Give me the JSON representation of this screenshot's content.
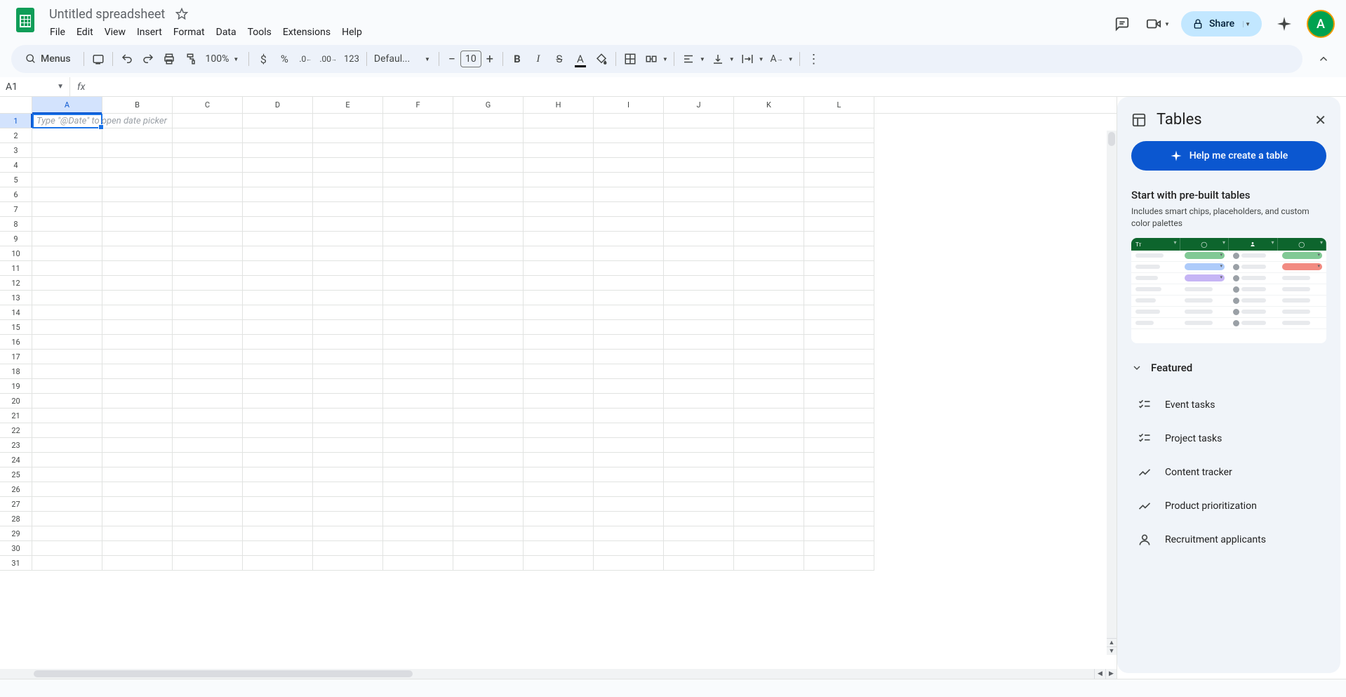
{
  "doc_title": "Untitled spreadsheet",
  "menus_label": "Menus",
  "menu": [
    "File",
    "Edit",
    "View",
    "Insert",
    "Format",
    "Data",
    "Tools",
    "Extensions",
    "Help"
  ],
  "share_label": "Share",
  "avatar_letter": "A",
  "toolbar": {
    "zoom": "100%",
    "font": "Defaul...",
    "font_size": "10",
    "format_123": "123"
  },
  "name_box": "A1",
  "active_cell_hint": "Type \"@Date\" to open date picker",
  "columns": [
    "A",
    "B",
    "C",
    "D",
    "E",
    "F",
    "G",
    "H",
    "I",
    "J",
    "K",
    "L"
  ],
  "row_count": 31,
  "side": {
    "title": "Tables",
    "cta": "Help me create a table",
    "prebuilt_h": "Start with pre-built tables",
    "prebuilt_sub": "Includes smart chips, placeholders, and custom color palettes",
    "featured": "Featured",
    "templates": [
      "Event tasks",
      "Project tasks",
      "Content tracker",
      "Product prioritization",
      "Recruitment applicants"
    ]
  }
}
